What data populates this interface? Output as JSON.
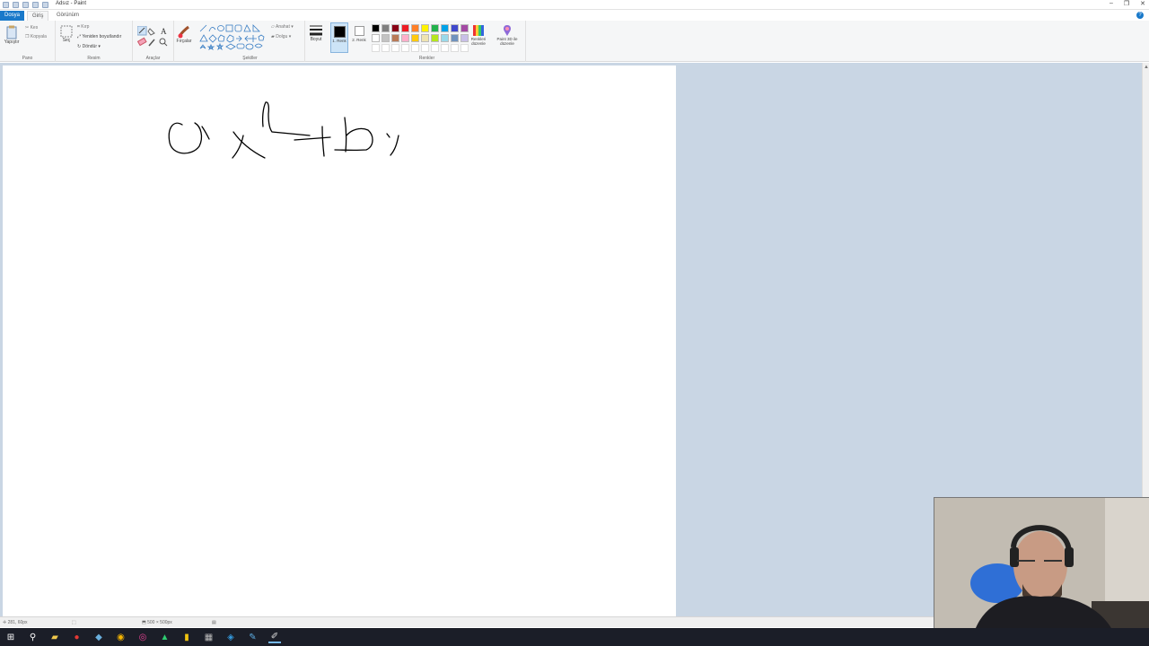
{
  "window": {
    "title": "Adsız - Paint",
    "controls": [
      "–",
      "❐",
      "✕"
    ]
  },
  "tabs": {
    "file": "Dosya",
    "home": "Giriş",
    "view": "Görünüm"
  },
  "ribbon": {
    "clipboard": {
      "paste": "Yapıştır",
      "cut": "Kes",
      "copy": "Kopyala",
      "label": "Pano"
    },
    "image": {
      "select": "Seç",
      "crop": "Kırp",
      "resize": "Yeniden boyutlandır",
      "rotate": "Döndür",
      "label": "Resim"
    },
    "tools": {
      "label": "Araçlar"
    },
    "brushes": {
      "label": "Fırçalar"
    },
    "shapes": {
      "outline": "Anahat",
      "fill": "Dolgu",
      "label": "Şekiller"
    },
    "size": {
      "label": "Boyut"
    },
    "colors": {
      "color1_label": "1. Renk",
      "color2_label": "2. Renk",
      "edit_colors": "Renkleri düzenle",
      "paint3d": "Paint 3D ile düzenle",
      "label": "Renkler",
      "color1": "#000000",
      "color2": "#ffffff",
      "palette_row1": [
        "#000000",
        "#7f7f7f",
        "#880015",
        "#ed1c24",
        "#ff7f27",
        "#fff200",
        "#22b14c",
        "#00a2e8",
        "#3f48cc",
        "#a349a4"
      ],
      "palette_row2": [
        "#ffffff",
        "#c3c3c3",
        "#b97a57",
        "#ffaec9",
        "#ffc90e",
        "#efe4b0",
        "#b5e61d",
        "#99d9ea",
        "#7092be",
        "#c8bfe7"
      ]
    }
  },
  "status": {
    "cursor_pos": "281, 60px",
    "canvas_size": "500 × 500px"
  },
  "taskbar": {
    "icons": [
      "start-icon",
      "search-icon",
      "explorer-icon",
      "app-red-icon",
      "steam-icon",
      "chrome-icon",
      "app-icon",
      "app-green-icon",
      "app-yellow-icon",
      "app-film-icon",
      "app-blue-icon",
      "paint-icon",
      "paint-active-icon"
    ]
  }
}
